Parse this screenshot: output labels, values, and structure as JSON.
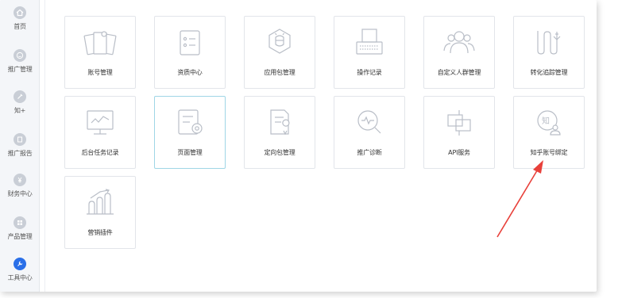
{
  "sidebar": {
    "items": [
      {
        "label": "首页",
        "icon": "home-icon",
        "active": false
      },
      {
        "label": "推广管理",
        "icon": "smile-icon",
        "active": false
      },
      {
        "label": "知+",
        "icon": "pen-icon",
        "active": false
      },
      {
        "label": "推广报告",
        "icon": "report-icon",
        "active": false
      },
      {
        "label": "财务中心",
        "icon": "yen-icon",
        "active": false
      },
      {
        "label": "产品管理",
        "icon": "grid-icon",
        "active": false
      },
      {
        "label": "工具中心",
        "icon": "tools-icon",
        "active": true
      }
    ]
  },
  "tools": [
    {
      "label": "账号管理",
      "icon": "cards-icon"
    },
    {
      "label": "资质中心",
      "icon": "certificate-icon"
    },
    {
      "label": "应用包管理",
      "icon": "app-package-icon"
    },
    {
      "label": "操作记录",
      "icon": "typewriter-icon"
    },
    {
      "label": "自定义人群管理",
      "icon": "audience-icon"
    },
    {
      "label": "转化追踪管理",
      "icon": "conversion-tracking-icon"
    },
    {
      "label": "后台任务记录",
      "icon": "monitor-chart-icon"
    },
    {
      "label": "页面管理",
      "icon": "page-settings-icon",
      "selected": true
    },
    {
      "label": "定向包管理",
      "icon": "targeting-doc-icon"
    },
    {
      "label": "推广诊断",
      "icon": "diagnosis-icon"
    },
    {
      "label": "API服务",
      "icon": "api-blocks-icon"
    },
    {
      "label": "知乎账号绑定",
      "icon": "zhihu-user-icon"
    },
    {
      "label": "营销插件",
      "icon": "marketing-plugin-icon"
    }
  ],
  "colors": {
    "accent": "#2a6fe8",
    "icon_stroke": "#b9bec7",
    "arrow": "#e8403a",
    "selected_border": "#9fd6e6"
  }
}
